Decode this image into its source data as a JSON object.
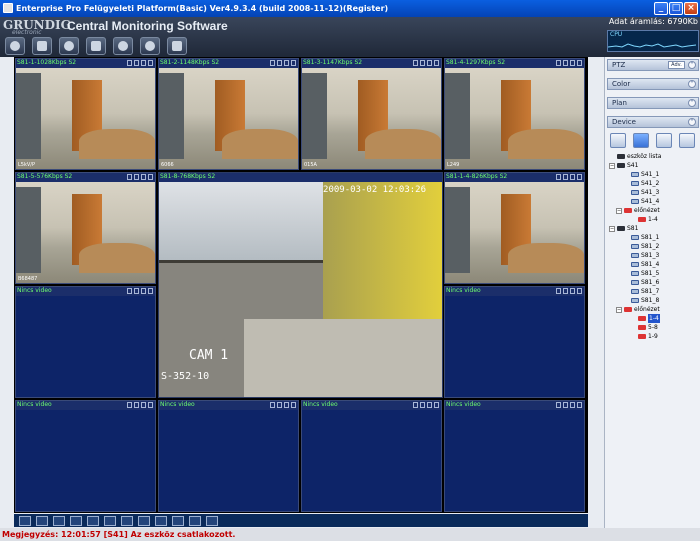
{
  "window": {
    "title": "Enterprise Pro Felügyeleti Platform(Basic)  Ver4.9.3.4 (build 2008-11-12)(Register)",
    "min_label": "_",
    "max_label": "□",
    "close_label": "×"
  },
  "header": {
    "brand": "GRUNDIG",
    "brand_sub": "electronic",
    "app_name": "Central Monitoring Software",
    "data_rate": "Adat áramlás: 6790Kb"
  },
  "toolbar": {
    "icons": [
      "eye-icon",
      "monitor-icon",
      "search-icon",
      "save-icon",
      "globe-icon",
      "gear-icon",
      "grid-icon"
    ]
  },
  "video": {
    "cells": [
      {
        "label": "S81-1-1028Kbps S2",
        "bl": "L5kV/P",
        "live": true
      },
      {
        "label": "S81-2-1148Kbps S2",
        "bl": "6066",
        "live": true
      },
      {
        "label": "S81-3-1147Kbps S2",
        "bl": "015A",
        "live": true
      },
      {
        "label": "S81-4-1297Kbps S2",
        "bl": "L249",
        "live": true
      },
      {
        "label": "S81-5-576Kbps S2",
        "bl": "B68487",
        "live": true
      },
      {
        "label": "S81-8-768Kbps S2",
        "bl": "",
        "live": true
      },
      {
        "label": "S81-1-4-826Kbps S2",
        "bl": "",
        "live": true
      },
      {
        "label": "Nincs video",
        "bl": "",
        "live": false
      },
      {
        "label": "Nincs video",
        "bl": "",
        "live": false
      },
      {
        "label": "Nincs video",
        "bl": "",
        "live": false
      },
      {
        "label": "Nincs video",
        "bl": "",
        "live": false
      },
      {
        "label": "Nincs video",
        "bl": "",
        "live": false
      },
      {
        "label": "Nincs video",
        "bl": "",
        "live": false
      }
    ],
    "big_cam": {
      "timestamp": "2009-03-02 12:03:26",
      "cam_label": "CAM  1",
      "plate_label": "S-352-10"
    }
  },
  "right_panel": {
    "cpu_label": "CPU",
    "sections": {
      "ptz": "PTZ",
      "ptz_btn": "Adv.",
      "color": "Color",
      "plan": "Plan",
      "device": "Device"
    },
    "tree": {
      "root": "eszköz lista",
      "s41": "S41",
      "s41_children": [
        "S41_1",
        "S41_2",
        "S41_3",
        "S41_4"
      ],
      "s41_preview": "előnézet",
      "s41_preview_children": [
        "1-4"
      ],
      "s81": "S81",
      "s81_children": [
        "S81_1",
        "S81_2",
        "S81_3",
        "S81_4",
        "S81_5",
        "S81_6",
        "S81_7",
        "S81_8"
      ],
      "s81_preview": "előnézet",
      "s81_preview_children": [
        "1-4",
        "5-8",
        "1-9"
      ]
    }
  },
  "status": {
    "text": "Megjegyzés:   12:01:57   [S41] Az eszköz csatlakozott."
  }
}
